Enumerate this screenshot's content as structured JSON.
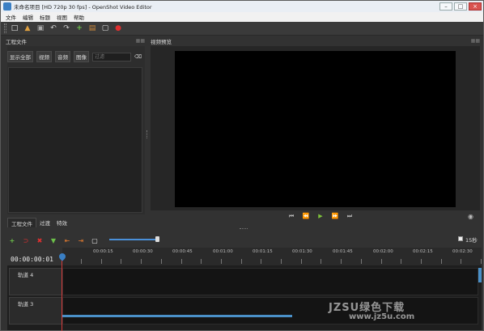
{
  "window": {
    "title": "未命名项目 [HD 720p 30 fps] - OpenShot Video Editor"
  },
  "menu": [
    "文件",
    "编辑",
    "标题",
    "视图",
    "帮助"
  ],
  "project_files": {
    "title": "工程文件",
    "filters": [
      "显示全部",
      "视频",
      "音频",
      "图像"
    ],
    "search_placeholder": "过滤",
    "clear_label": "⌫"
  },
  "bottom_tabs": [
    "工程文件",
    "过渡",
    "特效"
  ],
  "preview": {
    "title": "视频预览"
  },
  "timeline": {
    "timecode": "00:00:00:01",
    "zoom_label": "15秒",
    "ticks": [
      "00:00:15",
      "00:00:30",
      "00:00:45",
      "00:01:00",
      "00:01:15",
      "00:01:30",
      "00:01:45",
      "00:02:00",
      "00:02:15",
      "00:02:30"
    ],
    "tracks": [
      "轨道 4",
      "轨道 3"
    ]
  },
  "watermark": {
    "line1": "JZSU绿色下载",
    "line2": "www.jz5u.com"
  },
  "colors": {
    "accent": "#4a90d9",
    "playhead": "#d43a3a",
    "play_green": "#7ec23b"
  }
}
